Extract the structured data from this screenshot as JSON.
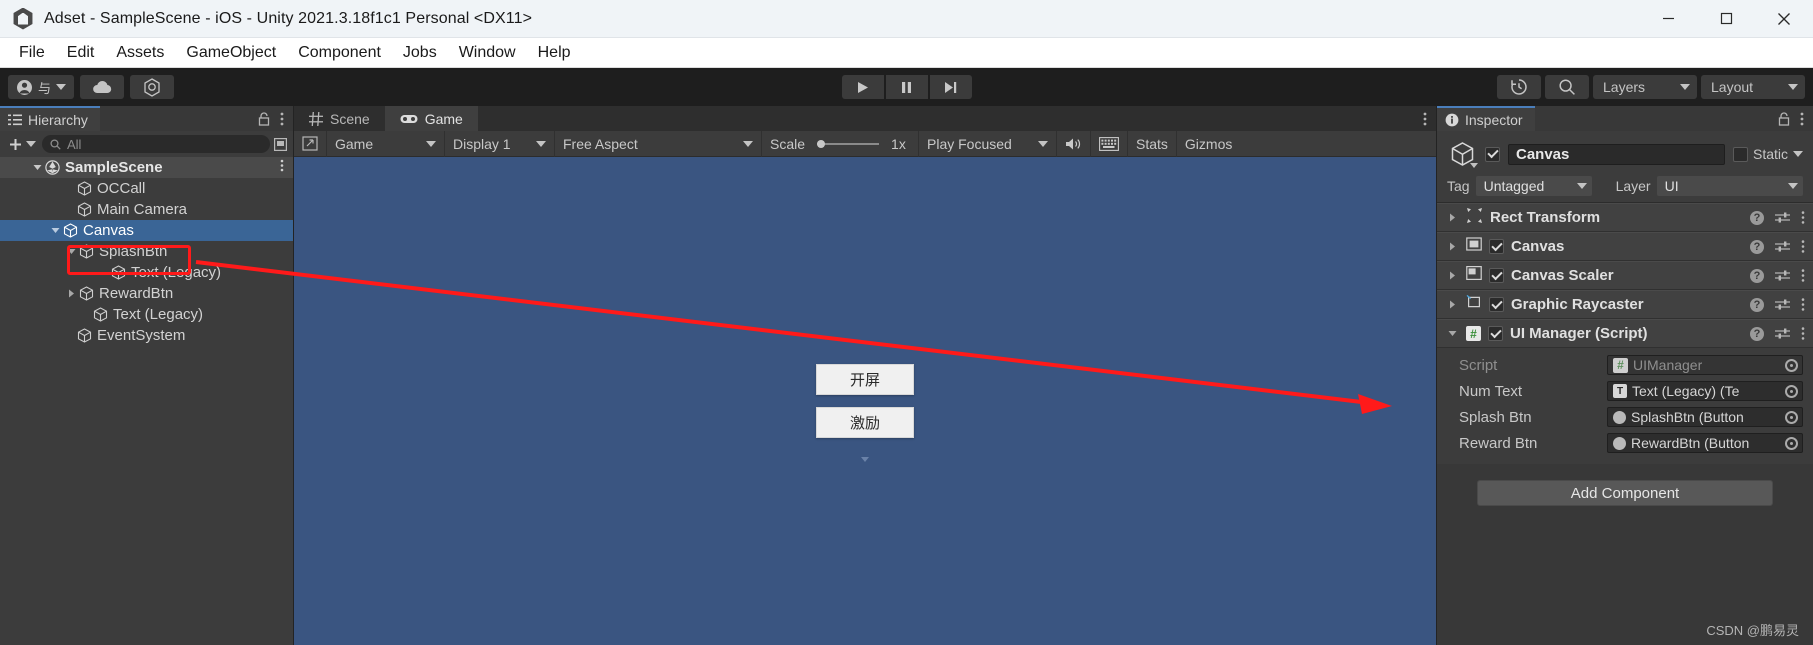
{
  "window": {
    "title": "Adset - SampleScene - iOS - Unity 2021.3.18f1c1 Personal <DX11>",
    "minimize": "—",
    "maximize": "☐",
    "close": "✕"
  },
  "menubar": {
    "items": [
      "File",
      "Edit",
      "Assets",
      "GameObject",
      "Component",
      "Jobs",
      "Window",
      "Help"
    ]
  },
  "toolbar": {
    "account_label": "与",
    "cloud_label": "",
    "collab_label": "",
    "play": "▶",
    "pause": "‖",
    "step": "▶|",
    "history_label": "",
    "search_label": "",
    "layers": "Layers",
    "layout": "Layout"
  },
  "hierarchy": {
    "tab_label": "Hierarchy",
    "add_label": "+",
    "search_placeholder": "All",
    "search_value": "",
    "items": [
      {
        "label": "SampleScene",
        "depth": 0,
        "arrow": "down",
        "type": "scene",
        "selected": false
      },
      {
        "label": "OCCall",
        "depth": 1,
        "arrow": "none",
        "type": "go",
        "selected": false
      },
      {
        "label": "Main Camera",
        "depth": 1,
        "arrow": "none",
        "type": "go",
        "selected": false
      },
      {
        "label": "Canvas",
        "depth": 1,
        "arrow": "down",
        "type": "go",
        "selected": true
      },
      {
        "label": "SplashBtn",
        "depth": 2,
        "arrow": "down",
        "type": "go",
        "selected": false
      },
      {
        "label": "Text (Legacy)",
        "depth": 3,
        "arrow": "none",
        "type": "go",
        "selected": false
      },
      {
        "label": "RewardBtn",
        "depth": 2,
        "arrow": "right",
        "type": "go",
        "selected": false
      },
      {
        "label": "Text (Legacy)",
        "depth": 2,
        "arrow": "none",
        "type": "go",
        "selected": false
      },
      {
        "label": "EventSystem",
        "depth": 1,
        "arrow": "none",
        "type": "go",
        "selected": false
      }
    ]
  },
  "center": {
    "tabs": [
      {
        "label": "Scene",
        "icon": "grid-icon",
        "active": false
      },
      {
        "label": "Game",
        "icon": "gamepad-icon",
        "active": true
      }
    ],
    "game_toolbar": {
      "view_mode": "Game",
      "display": "Display 1",
      "aspect": "Free Aspect",
      "scale_label": "Scale",
      "scale_value": "1x",
      "play_mode": "Play Focused",
      "stats": "Stats",
      "gizmos": "Gizmos"
    },
    "game_view": {
      "background_color": "#3a5581",
      "buttons": [
        "开屏",
        "激励"
      ]
    }
  },
  "inspector": {
    "tab_label": "Inspector",
    "object_name": "Canvas",
    "enabled": true,
    "static_label": "Static",
    "static_checked": false,
    "tag_label": "Tag",
    "tag_value": "Untagged",
    "layer_label": "Layer",
    "layer_value": "UI",
    "components": [
      {
        "name": "Rect Transform",
        "icon": "rect-transform-icon",
        "has_toggle": false,
        "enabled": false,
        "expanded": false
      },
      {
        "name": "Canvas",
        "icon": "canvas-icon",
        "has_toggle": true,
        "enabled": true,
        "expanded": false
      },
      {
        "name": "Canvas Scaler",
        "icon": "canvas-scaler-icon",
        "has_toggle": true,
        "enabled": true,
        "expanded": false
      },
      {
        "name": "Graphic Raycaster",
        "icon": "graphic-raycaster-icon",
        "has_toggle": true,
        "enabled": true,
        "expanded": false
      },
      {
        "name": "UI Manager (Script)",
        "icon": "script-icon",
        "has_toggle": true,
        "enabled": true,
        "expanded": true
      }
    ],
    "script_props": [
      {
        "label": "Script",
        "value": "UIManager",
        "icon": "script-icon",
        "dim": true
      },
      {
        "label": "Num Text",
        "value": "Text (Legacy) (Te",
        "icon": "text-icon",
        "dim": false
      },
      {
        "label": "Splash Btn",
        "value": "SplashBtn (Button",
        "icon": "button-icon",
        "dim": false
      },
      {
        "label": "Reward Btn",
        "value": "RewardBtn (Button",
        "icon": "button-icon",
        "dim": false
      }
    ],
    "add_component_label": "Add Component"
  },
  "annotation": {
    "highlight_color": "#ff1a1a",
    "arrow_from": "Canvas hierarchy item",
    "arrow_to": "UI Manager (Script) component"
  },
  "watermark": "CSDN @鹏易灵"
}
